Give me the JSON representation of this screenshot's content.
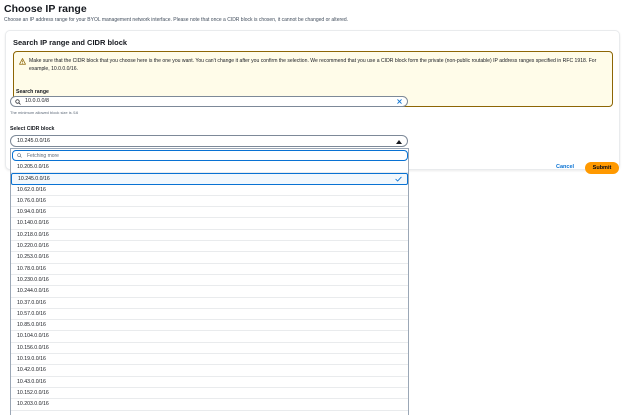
{
  "page": {
    "title": "Choose IP range",
    "description": "Choose an IP address range for your BYOL management network interface. Please note that once a CIDR block is chosen, it cannot be changed or altered."
  },
  "panel": {
    "header": "Search IP range and CIDR block",
    "alert_text": "Make sure that the CIDR block that you choose here is the one you want. You can't change it after you confirm the selection. We recommend that you use a CIDR block form the private (non-public routable) IP address ranges specified in RFC 1918. For example, 10.0.0.0/16."
  },
  "search": {
    "label": "Search range",
    "value": "10.0.0.0/8",
    "hint": "The minimum allowed block size is /16"
  },
  "cidr_select": {
    "label": "Select CIDR block",
    "selected": "10.245.0.0/16",
    "filter_placeholder": "Fetching more",
    "options": [
      {
        "label": "10.205.0.0/16",
        "selected": false
      },
      {
        "label": "10.245.0.0/16",
        "selected": true
      },
      {
        "label": "10.62.0.0/16",
        "selected": false
      },
      {
        "label": "10.76.0.0/16",
        "selected": false
      },
      {
        "label": "10.94.0.0/16",
        "selected": false
      },
      {
        "label": "10.140.0.0/16",
        "selected": false
      },
      {
        "label": "10.218.0.0/16",
        "selected": false
      },
      {
        "label": "10.220.0.0/16",
        "selected": false
      },
      {
        "label": "10.253.0.0/16",
        "selected": false
      },
      {
        "label": "10.78.0.0/16",
        "selected": false
      },
      {
        "label": "10.230.0.0/16",
        "selected": false
      },
      {
        "label": "10.244.0.0/16",
        "selected": false
      },
      {
        "label": "10.37.0.0/16",
        "selected": false
      },
      {
        "label": "10.57.0.0/16",
        "selected": false
      },
      {
        "label": "10.85.0.0/16",
        "selected": false
      },
      {
        "label": "10.104.0.0/16",
        "selected": false
      },
      {
        "label": "10.156.0.0/16",
        "selected": false
      },
      {
        "label": "10.19.0.0/16",
        "selected": false
      },
      {
        "label": "10.42.0.0/16",
        "selected": false
      },
      {
        "label": "10.43.0.0/16",
        "selected": false
      },
      {
        "label": "10.152.0.0/16",
        "selected": false
      },
      {
        "label": "10.203.0.0/16",
        "selected": false
      }
    ]
  },
  "actions": {
    "cancel": "Cancel",
    "submit": "Submit"
  },
  "icons": {
    "alert": "warning-triangle-icon",
    "search": "search-icon",
    "clear": "close-icon",
    "caret": "caret-up-icon",
    "check": "checkmark-icon"
  },
  "colors": {
    "accent": "#0972d3",
    "primary_button": "#ff9900",
    "warning_bg": "#fffce9",
    "warning_border": "#8d6605"
  }
}
